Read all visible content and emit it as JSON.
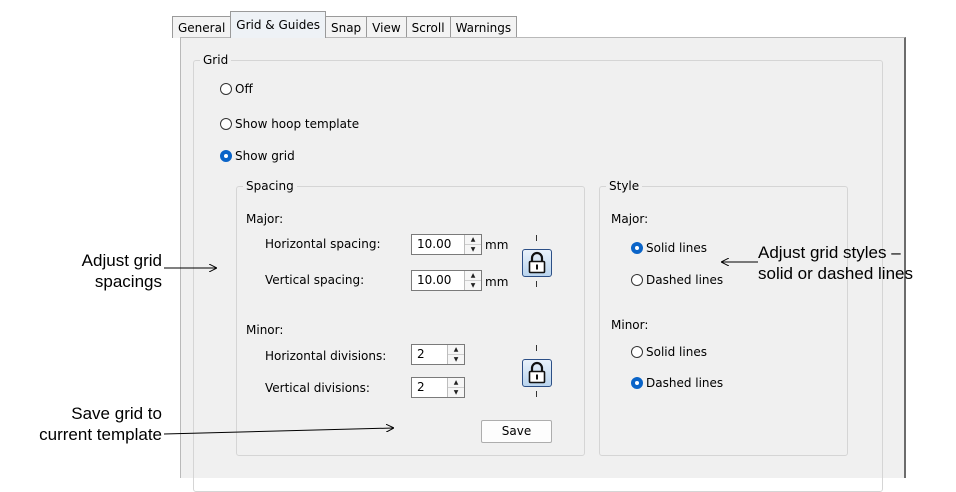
{
  "tabs": [
    {
      "label": "General",
      "active": false
    },
    {
      "label": "Grid & Guides",
      "active": true
    },
    {
      "label": "Snap",
      "active": false
    },
    {
      "label": "View",
      "active": false
    },
    {
      "label": "Scroll",
      "active": false
    },
    {
      "label": "Warnings",
      "active": false
    }
  ],
  "grid": {
    "title": "Grid",
    "options": [
      {
        "label": "Off",
        "checked": false
      },
      {
        "label": "Show hoop template",
        "checked": false
      },
      {
        "label": "Show grid",
        "checked": true
      }
    ]
  },
  "spacing": {
    "title": "Spacing",
    "major_label": "Major:",
    "horizontal_spacing_label": "Horizontal spacing:",
    "horizontal_spacing_value": "10.00",
    "vertical_spacing_label": "Vertical spacing:",
    "vertical_spacing_value": "10.00",
    "unit": "mm",
    "minor_label": "Minor:",
    "horizontal_divisions_label": "Horizontal divisions:",
    "horizontal_divisions_value": "2",
    "vertical_divisions_label": "Vertical divisions:",
    "vertical_divisions_value": "2",
    "save_label": "Save"
  },
  "style": {
    "title": "Style",
    "major_label": "Major:",
    "major_options": [
      {
        "label": "Solid lines",
        "checked": true
      },
      {
        "label": "Dashed lines",
        "checked": false
      }
    ],
    "minor_label": "Minor:",
    "minor_options": [
      {
        "label": "Solid lines",
        "checked": false
      },
      {
        "label": "Dashed lines",
        "checked": true
      }
    ]
  },
  "annotations": {
    "spacings": [
      "Adjust grid",
      "spacings"
    ],
    "save": [
      "Save grid to",
      "current template"
    ],
    "styles": [
      "Adjust grid styles –",
      "solid or dashed lines"
    ]
  },
  "colors": {
    "radio_selected": "#0a64c8",
    "dialog_bg": "#f0f0f0",
    "active_tab_bg": "#eef2f6"
  },
  "icons": {
    "lock": "padlock-icon",
    "spin_up": "arrow-up-icon",
    "spin_down": "arrow-down-icon"
  }
}
